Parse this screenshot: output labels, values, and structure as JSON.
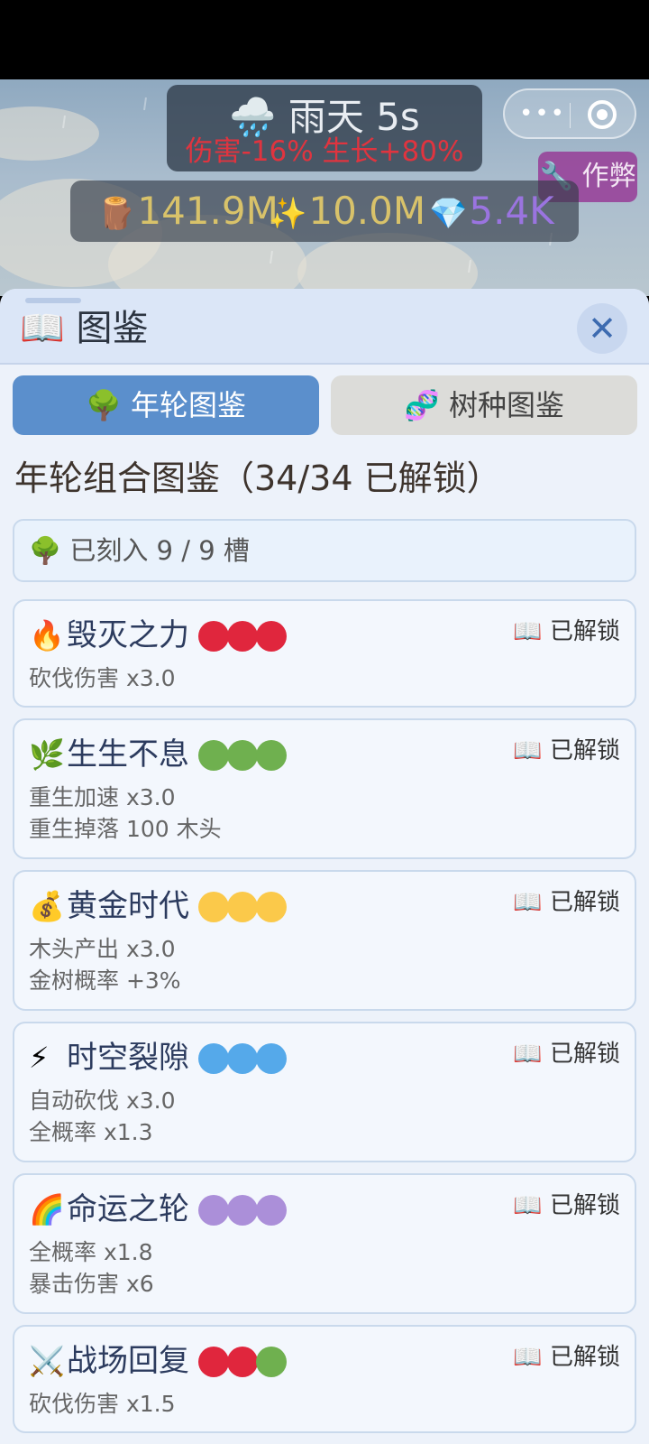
{
  "weather": {
    "icon": "🌧️",
    "title": "雨天 5s",
    "effect": "伤害-16% 生长+80%"
  },
  "cheat_button": {
    "icon": "🔧",
    "label": "作弊"
  },
  "resources": [
    {
      "icon": "🪵",
      "value": "141.9M",
      "color": "#d8c26a"
    },
    {
      "icon": "✨",
      "value": "10.0M",
      "color": "#d8c26a"
    },
    {
      "icon": "💎",
      "value": "5.4K",
      "color": "#9a74e0"
    }
  ],
  "panel": {
    "icon": "📖",
    "title": "图鉴",
    "close_glyph": "✕"
  },
  "tabs": [
    {
      "icon": "🌳",
      "label": "年轮图鉴",
      "active": true
    },
    {
      "icon": "🧬",
      "label": "树种图鉴",
      "active": false
    }
  ],
  "section_title": "年轮组合图鉴（34/34 已解锁）",
  "slot_summary": {
    "icon": "🌳",
    "text": "已刻入 9 / 9 槽"
  },
  "colors": {
    "red": "#e0263d",
    "green": "#6fb04f",
    "yellow": "#fbc94a",
    "blue": "#55a9ea",
    "purple": "#ab8fd9"
  },
  "cards": [
    {
      "icon": "🔥",
      "name": "毁灭之力",
      "dots": [
        "red",
        "red",
        "red"
      ],
      "status": "📖 已解锁",
      "effects": [
        "砍伐伤害 x3.0"
      ]
    },
    {
      "icon": "🌿",
      "name": "生生不息",
      "dots": [
        "green",
        "green",
        "green"
      ],
      "status": "📖 已解锁",
      "effects": [
        "重生加速 x3.0",
        "重生掉落 100 木头"
      ]
    },
    {
      "icon": "💰",
      "name": "黄金时代",
      "dots": [
        "yellow",
        "yellow",
        "yellow"
      ],
      "status": "📖 已解锁",
      "effects": [
        "木头产出 x3.0",
        "金树概率 +3%"
      ]
    },
    {
      "icon": "⚡",
      "name": "时空裂隙",
      "dots": [
        "blue",
        "blue",
        "blue"
      ],
      "status": "📖 已解锁",
      "effects": [
        "自动砍伐 x3.0",
        "全概率 x1.3"
      ]
    },
    {
      "icon": "🌈",
      "name": "命运之轮",
      "dots": [
        "purple",
        "purple",
        "purple"
      ],
      "status": "📖 已解锁",
      "effects": [
        "全概率 x1.8",
        "暴击伤害 x6"
      ]
    },
    {
      "icon": "⚔️",
      "name": "战场回复",
      "dots": [
        "red",
        "red",
        "green"
      ],
      "status": "📖 已解锁",
      "effects": [
        "砍伐伤害 x1.5"
      ]
    }
  ]
}
